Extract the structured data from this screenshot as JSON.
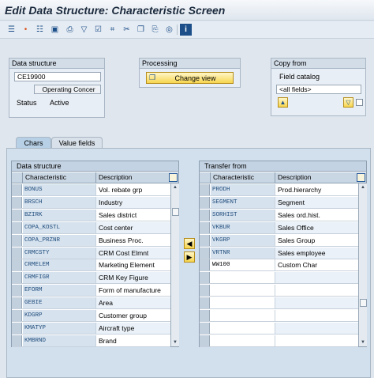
{
  "window": {
    "title": "Edit Data Structure: Characteristic Screen"
  },
  "toolbar": {
    "icons": [
      "tree-icon",
      "info-dot-icon",
      "hierarchy-icon",
      "save-layout-icon",
      "print-icon",
      "filter-icon",
      "select-all-icon",
      "find-icon",
      "cut-icon",
      "copy-icon",
      "paste-icon",
      "local-layout-icon",
      "global-layout-icon",
      "info-icon"
    ]
  },
  "data_structure": {
    "title": "Data structure",
    "id": "CE19900",
    "name": "Operating Concer",
    "status_label": "Status",
    "status_value": "Active"
  },
  "processing": {
    "title": "Processing",
    "change_view": "Change view"
  },
  "copy_from": {
    "title": "Copy from",
    "catalog_label": "Field catalog",
    "catalog_value": "<all fields>"
  },
  "tabs": [
    {
      "label": "Chars",
      "active": true
    },
    {
      "label": "Value fields",
      "active": false
    }
  ],
  "left_table": {
    "title": "Data structure",
    "col1": "Characteristic",
    "col2": "Description",
    "rows": [
      {
        "char": "BONUS",
        "desc": "Vol. rebate grp"
      },
      {
        "char": "BRSCH",
        "desc": "Industry"
      },
      {
        "char": "BZIRK",
        "desc": "Sales district"
      },
      {
        "char": "COPA_KOSTL",
        "desc": "Cost center"
      },
      {
        "char": "COPA_PRZNR",
        "desc": "Business Proc."
      },
      {
        "char": "CRMCSTY",
        "desc": "CRM Cost Elmnt"
      },
      {
        "char": "CRMELEM",
        "desc": "Marketing Element"
      },
      {
        "char": "CRMFIGR",
        "desc": "CRM Key Figure"
      },
      {
        "char": "EFORM",
        "desc": "Form of manufacture"
      },
      {
        "char": "GEBIE",
        "desc": "Area"
      },
      {
        "char": "KDGRP",
        "desc": "Customer group"
      },
      {
        "char": "KMATYP",
        "desc": "Aircraft type"
      },
      {
        "char": "KMBRND",
        "desc": "Brand"
      }
    ]
  },
  "right_table": {
    "title": "Transfer from",
    "col1": "Characteristic",
    "col2": "Description",
    "rows": [
      {
        "char": "PRODH",
        "desc": "Prod.hierarchy"
      },
      {
        "char": "SEGMENT",
        "desc": "Segment"
      },
      {
        "char": "SORHIST",
        "desc": "Sales ord.hist."
      },
      {
        "char": "VKBUR",
        "desc": "Sales Office"
      },
      {
        "char": "VKGRP",
        "desc": "Sales Group"
      },
      {
        "char": "VRTNR",
        "desc": "Sales employee"
      },
      {
        "char": "WW100",
        "desc": "Custom Char"
      },
      {
        "char": "",
        "desc": ""
      },
      {
        "char": "",
        "desc": ""
      },
      {
        "char": "",
        "desc": ""
      },
      {
        "char": "",
        "desc": ""
      },
      {
        "char": "",
        "desc": ""
      },
      {
        "char": "",
        "desc": ""
      }
    ]
  },
  "move": {
    "left_arrow": "◀",
    "right_arrow": "▶"
  }
}
